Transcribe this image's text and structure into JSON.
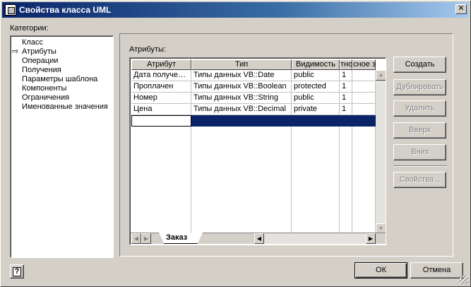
{
  "window": {
    "title": "Свойства класса UML",
    "close_glyph": "✕"
  },
  "categories": {
    "label": "Категории:",
    "items": [
      {
        "label": "Класс",
        "selected": false
      },
      {
        "label": "Атрибуты",
        "selected": true
      },
      {
        "label": "Операции",
        "selected": false
      },
      {
        "label": "Получения",
        "selected": false
      },
      {
        "label": "Параметры шаблона",
        "selected": false
      },
      {
        "label": "Компоненты",
        "selected": false
      },
      {
        "label": "Ограничения",
        "selected": false
      },
      {
        "label": "Именованные значения",
        "selected": false
      }
    ],
    "selected_marker": "⇨"
  },
  "attributes": {
    "label": "Атрибуты:",
    "columns": [
      "Атрибут",
      "Тип",
      "Видимость",
      "тно",
      "сное зн"
    ],
    "rows": [
      [
        "Дата получе…",
        "Типы данных VB::Date",
        "public",
        "1",
        ""
      ],
      [
        "Проплачен",
        "Типы данных VB::Boolean",
        "protected",
        "1",
        ""
      ],
      [
        "Номер",
        "Типы данных VB::String",
        "public",
        "1",
        ""
      ],
      [
        "Цена",
        "Типы данных VB::Decimal",
        "private",
        "1",
        ""
      ]
    ],
    "sheet_tab": "Заказ"
  },
  "buttons": {
    "create": "Создать",
    "duplicate": "Дублировать",
    "delete": "Удалить",
    "up": "Вверх",
    "down": "Вниз",
    "properties": "Свойства...",
    "ok": "ОК",
    "cancel": "Отмена",
    "help": "?"
  }
}
